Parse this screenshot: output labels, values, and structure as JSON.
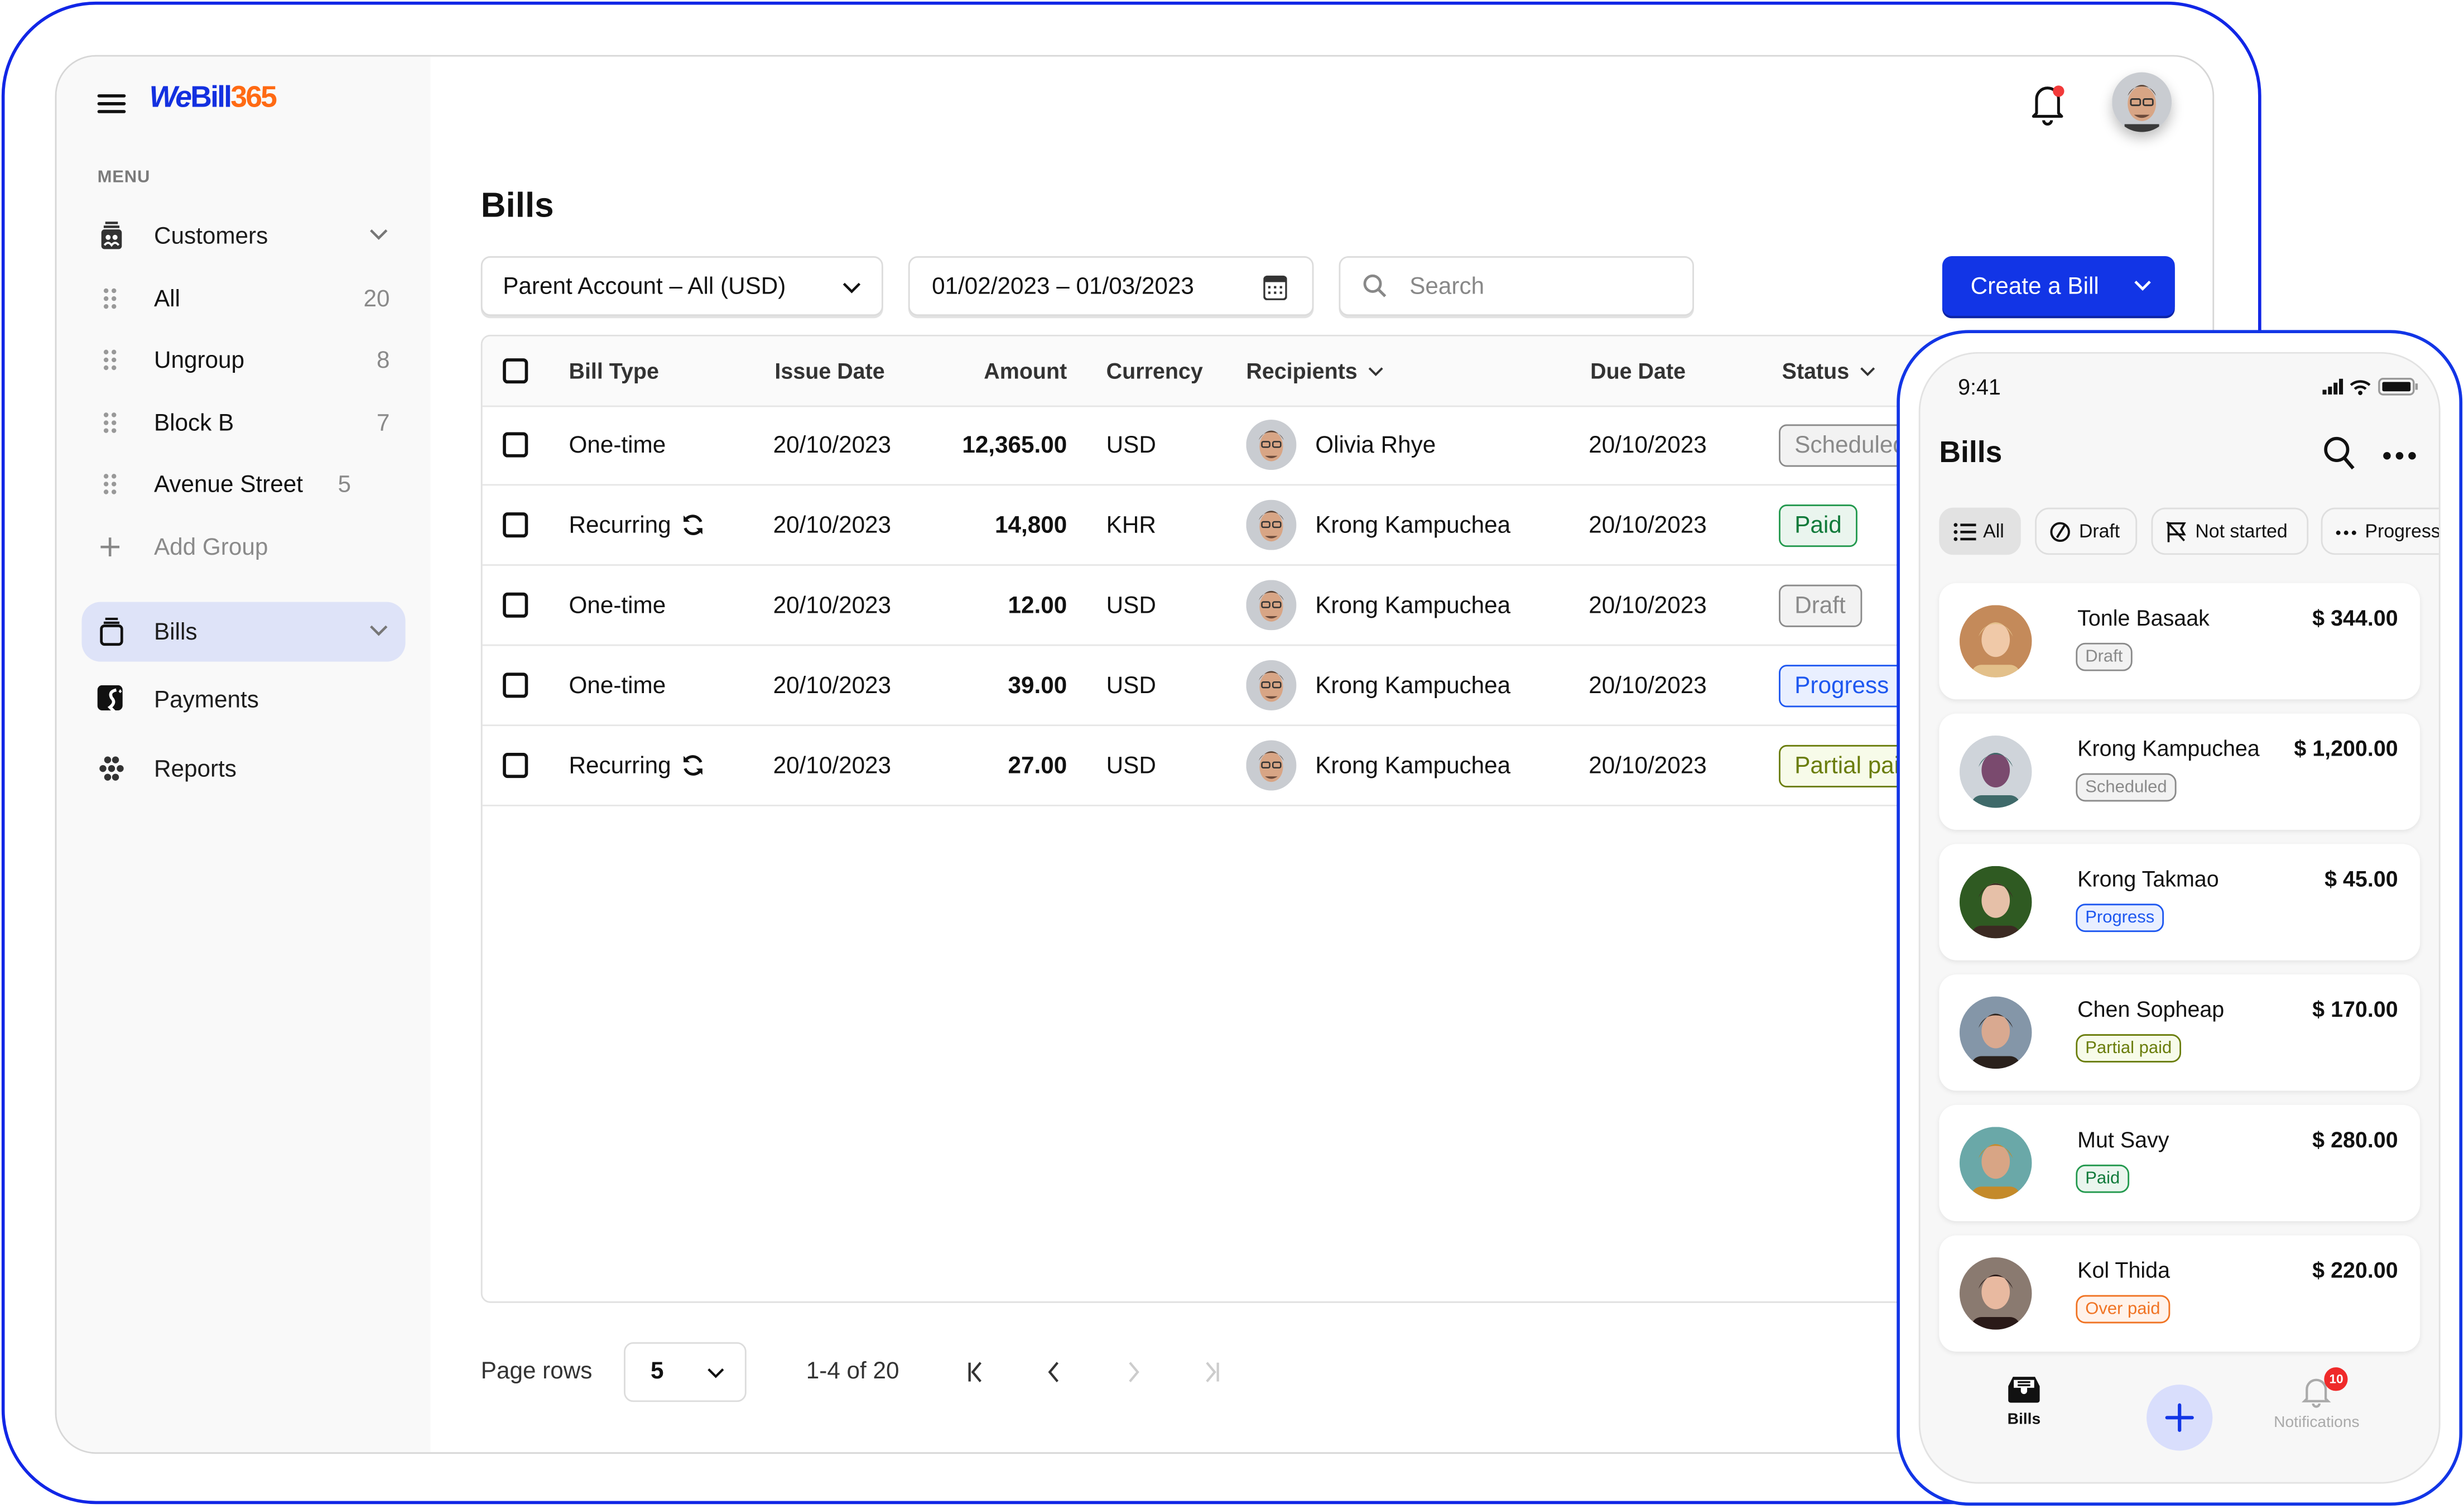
{
  "app": {
    "logo": {
      "we": "We",
      "bill": "Bill",
      "n365": "365"
    },
    "brand_colors": {
      "primary": "#1235e6",
      "accent": "#ff6a13"
    }
  },
  "sidebar": {
    "menu_label": "MENU",
    "customers": {
      "label": "Customers",
      "icon": "customers-icon"
    },
    "groups": [
      {
        "label": "All",
        "count": "20"
      },
      {
        "label": "Ungroup",
        "count": "8"
      },
      {
        "label": "Block B",
        "count": "7"
      },
      {
        "label": "Avenue Street",
        "count": "5"
      }
    ],
    "add_group": "Add Group",
    "bills": {
      "label": "Bills",
      "icon": "bills-icon",
      "active": true
    },
    "payments": {
      "label": "Payments",
      "icon": "payments-icon"
    },
    "reports": {
      "label": "Reports",
      "icon": "reports-icon"
    }
  },
  "header": {
    "title": "Bills",
    "account_select": "Parent Account – All (USD)",
    "date_range": "01/02/2023 – 01/03/2023",
    "search_placeholder": "Search",
    "create_button": "Create a Bill"
  },
  "table": {
    "columns": {
      "bill_type": "Bill Type",
      "issue_date": "Issue Date",
      "amount": "Amount",
      "currency": "Currency",
      "recipients": "Recipients",
      "due_date": "Due Date",
      "status": "Status"
    },
    "rows": [
      {
        "bill_type": "One-time",
        "recurring": false,
        "issue_date": "20/10/2023",
        "amount": "12,365.00",
        "currency": "USD",
        "recipient": "Olivia Rhye",
        "due_date": "20/10/2023",
        "status": "Scheduled",
        "status_kind": "scheduled"
      },
      {
        "bill_type": "Recurring",
        "recurring": true,
        "issue_date": "20/10/2023",
        "amount": "14,800",
        "currency": "KHR",
        "recipient": "Krong Kampuchea",
        "due_date": "20/10/2023",
        "status": "Paid",
        "status_kind": "paid"
      },
      {
        "bill_type": "One-time",
        "recurring": false,
        "issue_date": "20/10/2023",
        "amount": "12.00",
        "currency": "USD",
        "recipient": "Krong Kampuchea",
        "due_date": "20/10/2023",
        "status": "Draft",
        "status_kind": "draft"
      },
      {
        "bill_type": "One-time",
        "recurring": false,
        "issue_date": "20/10/2023",
        "amount": "39.00",
        "currency": "USD",
        "recipient": "Krong Kampuchea",
        "due_date": "20/10/2023",
        "status": "Progress",
        "status_kind": "progress"
      },
      {
        "bill_type": "Recurring",
        "recurring": true,
        "issue_date": "20/10/2023",
        "amount": "27.00",
        "currency": "USD",
        "recipient": "Krong Kampuchea",
        "due_date": "20/10/2023",
        "status": "Partial paid",
        "status_kind": "partial"
      }
    ]
  },
  "pagination": {
    "label": "Page rows",
    "rows_per_page": "5",
    "range": "1-4 of 20"
  },
  "mobile": {
    "status_time": "9:41",
    "title": "Bills",
    "filters": [
      {
        "label": "All",
        "icon": "list-icon",
        "active": true
      },
      {
        "label": "Draft",
        "icon": "draft-icon",
        "active": false
      },
      {
        "label": "Not started",
        "icon": "flag-off-icon",
        "active": false
      },
      {
        "label": "Progress",
        "icon": "dots-icon",
        "active": false
      }
    ],
    "bills": [
      {
        "name": "Tonle Basaak",
        "amount": "$ 344.00",
        "status": "Draft",
        "status_kind": "draft"
      },
      {
        "name": "Krong Kampuchea",
        "amount": "$ 1,200.00",
        "status": "Scheduled",
        "status_kind": "scheduled"
      },
      {
        "name": "Krong Takmao",
        "amount": "$ 45.00",
        "status": "Progress",
        "status_kind": "progress"
      },
      {
        "name": "Chen Sopheap",
        "amount": "$ 170.00",
        "status": "Partial paid",
        "status_kind": "partial"
      },
      {
        "name": "Mut Savy",
        "amount": "$ 280.00",
        "status": "Paid",
        "status_kind": "paid"
      },
      {
        "name": "Kol Thida",
        "amount": "$ 220.00",
        "status": "Over paid",
        "status_kind": "over"
      }
    ],
    "tabbar": {
      "bills": "Bills",
      "notifications": "Notifications",
      "notification_count": "10"
    }
  }
}
